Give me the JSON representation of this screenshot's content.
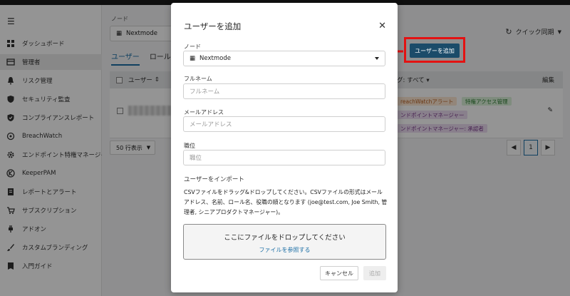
{
  "sidebar": {
    "items": [
      {
        "label": "ダッシュボード",
        "icon": "grid-icon"
      },
      {
        "label": "管理者",
        "icon": "admin-icon"
      },
      {
        "label": "リスク管理",
        "icon": "bell-icon"
      },
      {
        "label": "セキュリティ監査",
        "icon": "shield-icon"
      },
      {
        "label": "コンプライアンスレポート",
        "icon": "check-shield-icon"
      },
      {
        "label": "BreachWatch",
        "icon": "radar-icon"
      },
      {
        "label": "エンドポイント特権マネージャ",
        "icon": "gear-icon"
      },
      {
        "label": "KeeperPAM",
        "icon": "keeper-icon"
      },
      {
        "label": "レポートとアラート",
        "icon": "report-icon"
      },
      {
        "label": "サブスクリプション",
        "icon": "cart-icon"
      },
      {
        "label": "アドオン",
        "icon": "plug-icon"
      },
      {
        "label": "カスタムブランディング",
        "icon": "brush-icon"
      },
      {
        "label": "入門ガイド",
        "icon": "guide-icon"
      }
    ]
  },
  "main": {
    "node_label": "ノード",
    "node_value": "Nextmode",
    "tabs": [
      "ユーザー",
      "ロール"
    ],
    "sync_label": "クイック同期",
    "add_user_label": "ユーザーを追加",
    "table": {
      "col_user": "ユーザー",
      "col_tag": "グ: すべて",
      "col_edit": "編集",
      "tags": [
        "reachWatchアラート",
        "特権アクセス管理",
        "ンドポイントマネージャー",
        "ンドポイントマネージャー: 承認者"
      ]
    },
    "per_page": "50 行表示",
    "current_page": "1"
  },
  "modal": {
    "title": "ユーザーを追加",
    "node_label": "ノード",
    "node_value": "Nextmode",
    "fullname_label": "フルネーム",
    "fullname_placeholder": "フルネーム",
    "email_label": "メールアドレス",
    "email_placeholder": "メールアドレス",
    "position_label": "職位",
    "position_placeholder": "職位",
    "import_title": "ユーザーをインポート",
    "import_desc": "CSVファイルをドラッグ&ドロップしてください。CSVファイルの形式はメールアドレス、名前、ロール名、役職の順となります (joe@test.com, Joe Smith, 管理者, シニアプロダクトマネージャー)。",
    "dropzone_title": "ここにファイルをドロップしてください",
    "dropzone_link": "ファイルを参照する",
    "cancel_label": "キャンセル",
    "add_label": "追加"
  },
  "colors": {
    "accent": "#1c6fa6",
    "primary_button": "#1b4b69",
    "highlight_red": "#e41212"
  }
}
